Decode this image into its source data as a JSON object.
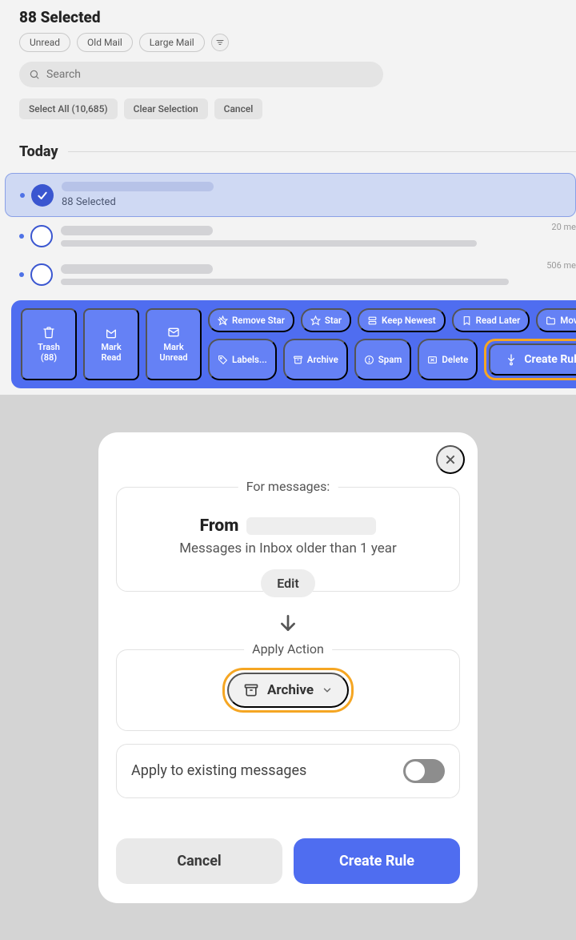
{
  "header": {
    "title": "88 Selected",
    "filters": [
      "Unread",
      "Old Mail",
      "Large Mail"
    ]
  },
  "search": {
    "placeholder": "Search"
  },
  "selection_actions": {
    "select_all": "Select All (10,685)",
    "clear": "Clear Selection",
    "cancel": "Cancel"
  },
  "section": {
    "today": "Today"
  },
  "rows": {
    "selected_label": "88 Selected",
    "meta1": "20 me",
    "meta2": "506 me"
  },
  "action_bar": {
    "trash": "Trash (88)",
    "mark_read": "Mark Read",
    "mark_unread": "Mark Unread",
    "remove_star": "Remove Star",
    "star": "Star",
    "keep_newest": "Keep Newest",
    "read_later": "Read Later",
    "move": "Move...",
    "labels": "Labels...",
    "archive": "Archive",
    "spam": "Spam",
    "delete": "Delete",
    "create_rule": "Create Rule"
  },
  "modal": {
    "for_messages": "For messages:",
    "from_label": "From",
    "condition": "Messages in Inbox older than 1 year",
    "edit": "Edit",
    "apply_action": "Apply Action",
    "action_value": "Archive",
    "apply_existing": "Apply to existing messages",
    "cancel": "Cancel",
    "create": "Create Rule"
  },
  "colors": {
    "accent": "#4f6df0",
    "highlight": "#f5a623"
  }
}
